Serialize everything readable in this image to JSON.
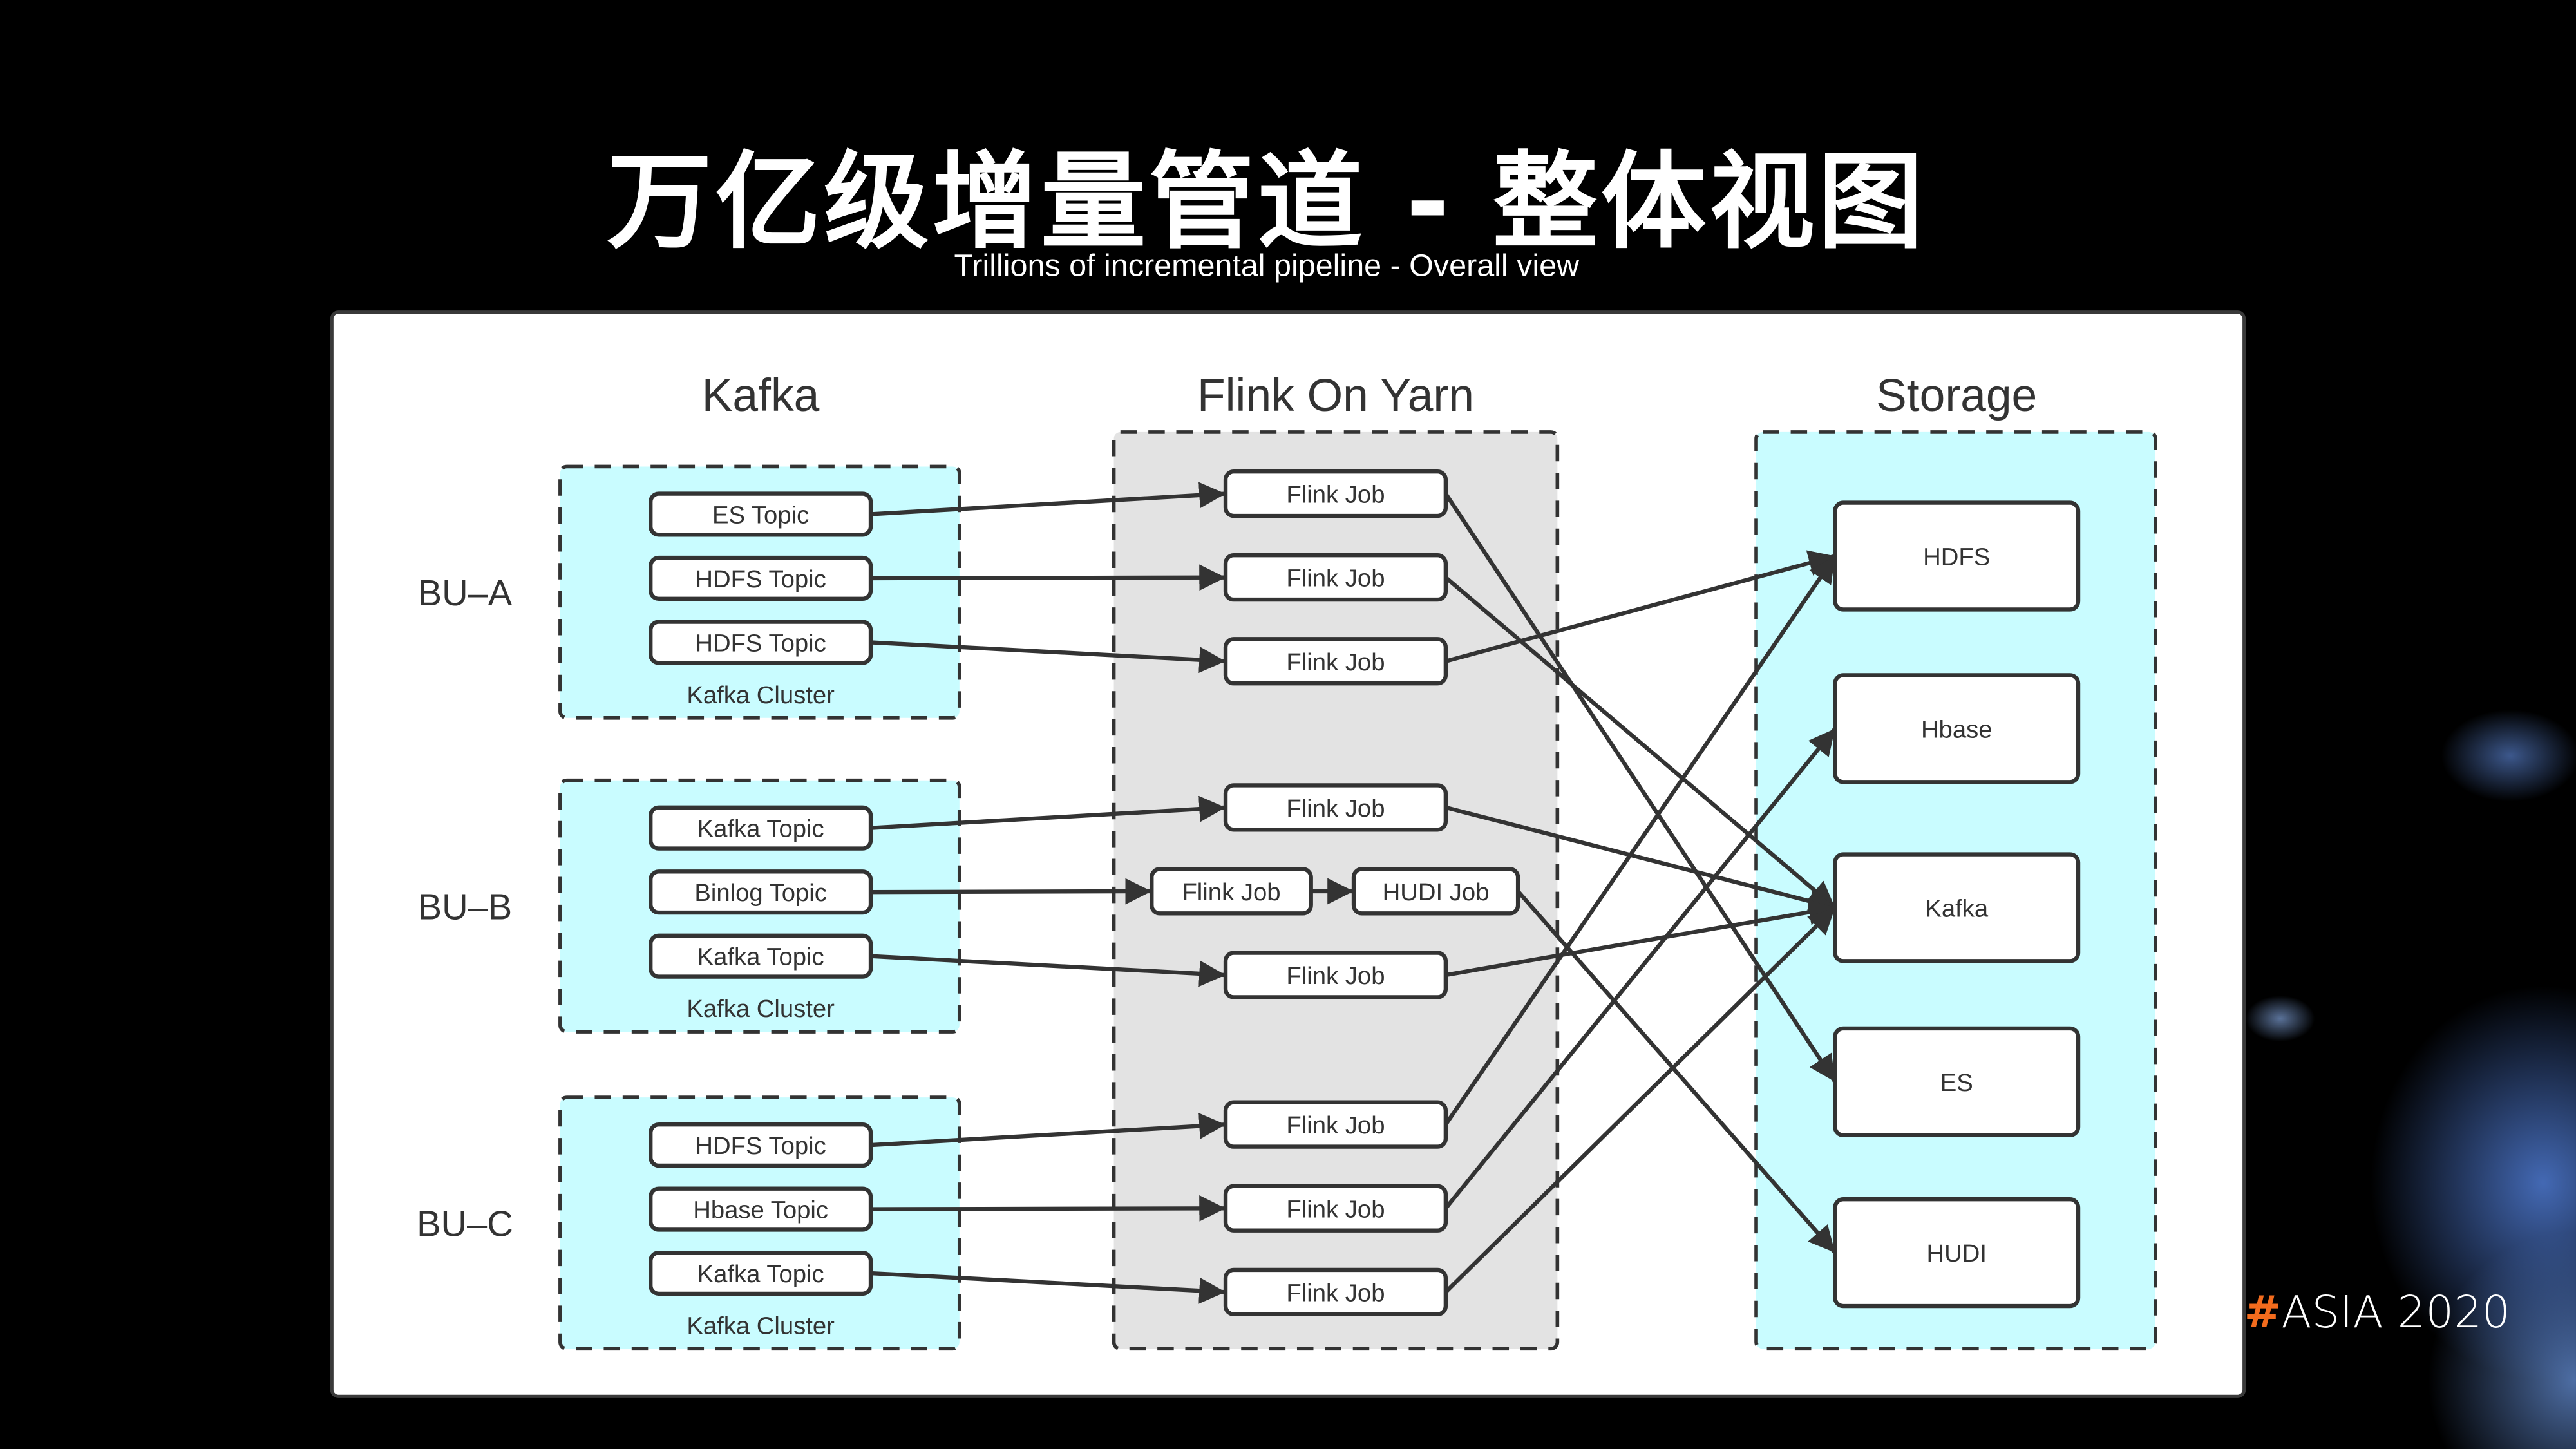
{
  "slide": {
    "title": "万亿级增量管道 - 整体视图",
    "subtitle": "Trillions of incremental pipeline - Overall view",
    "event_tag": {
      "hash": "#",
      "text": "ASIA 2020"
    }
  },
  "diagram": {
    "columns": {
      "kafka": "Kafka",
      "flink": "Flink On Yarn",
      "storage": "Storage"
    },
    "colors": {
      "cluster_fill": "#c9fcff",
      "flink_fill": "#e3e3e3",
      "stroke": "#333333",
      "node_fill": "#ffffff",
      "event_hash": "#f26b1d"
    },
    "business_units": [
      {
        "label": "BU–A",
        "cluster_label": "Kafka Cluster",
        "topics": [
          "ES Topic",
          "HDFS Topic",
          "HDFS Topic"
        ]
      },
      {
        "label": "BU–B",
        "cluster_label": "Kafka Cluster",
        "topics": [
          "Kafka Topic",
          "Binlog Topic",
          "Kafka Topic"
        ]
      },
      {
        "label": "BU–C",
        "cluster_label": "Kafka Cluster",
        "topics": [
          "HDFS Topic",
          "Hbase Topic",
          "Kafka Topic"
        ]
      }
    ],
    "jobs": [
      {
        "id": "j1",
        "label": "Flink Job"
      },
      {
        "id": "j2",
        "label": "Flink Job"
      },
      {
        "id": "j3",
        "label": "Flink Job"
      },
      {
        "id": "j4",
        "label": "Flink Job"
      },
      {
        "id": "j5",
        "label": "Flink Job"
      },
      {
        "id": "j5h",
        "label": "HUDI Job"
      },
      {
        "id": "j6",
        "label": "Flink Job"
      },
      {
        "id": "j7",
        "label": "Flink Job"
      },
      {
        "id": "j8",
        "label": "Flink Job"
      },
      {
        "id": "j9",
        "label": "Flink Job"
      }
    ],
    "storage": [
      {
        "id": "s_hdfs",
        "label": "HDFS"
      },
      {
        "id": "s_hbase",
        "label": "Hbase"
      },
      {
        "id": "s_kafka",
        "label": "Kafka"
      },
      {
        "id": "s_es",
        "label": "ES"
      },
      {
        "id": "s_hudi",
        "label": "HUDI"
      }
    ],
    "edges": [
      {
        "from": "t0",
        "to": "j1"
      },
      {
        "from": "t1",
        "to": "j2"
      },
      {
        "from": "t2",
        "to": "j3"
      },
      {
        "from": "t3",
        "to": "j4"
      },
      {
        "from": "t4",
        "to": "j5"
      },
      {
        "from": "j5",
        "to": "j5h"
      },
      {
        "from": "t5",
        "to": "j6"
      },
      {
        "from": "t6",
        "to": "j7"
      },
      {
        "from": "t7",
        "to": "j8"
      },
      {
        "from": "t8",
        "to": "j9"
      },
      {
        "from": "j1",
        "to": "s_es"
      },
      {
        "from": "j2",
        "to": "s_kafka"
      },
      {
        "from": "j3",
        "to": "s_hdfs"
      },
      {
        "from": "j4",
        "to": "s_kafka"
      },
      {
        "from": "j5h",
        "to": "s_hudi"
      },
      {
        "from": "j6",
        "to": "s_kafka"
      },
      {
        "from": "j7",
        "to": "s_hdfs"
      },
      {
        "from": "j8",
        "to": "s_hbase"
      },
      {
        "from": "j9",
        "to": "s_kafka"
      }
    ]
  }
}
